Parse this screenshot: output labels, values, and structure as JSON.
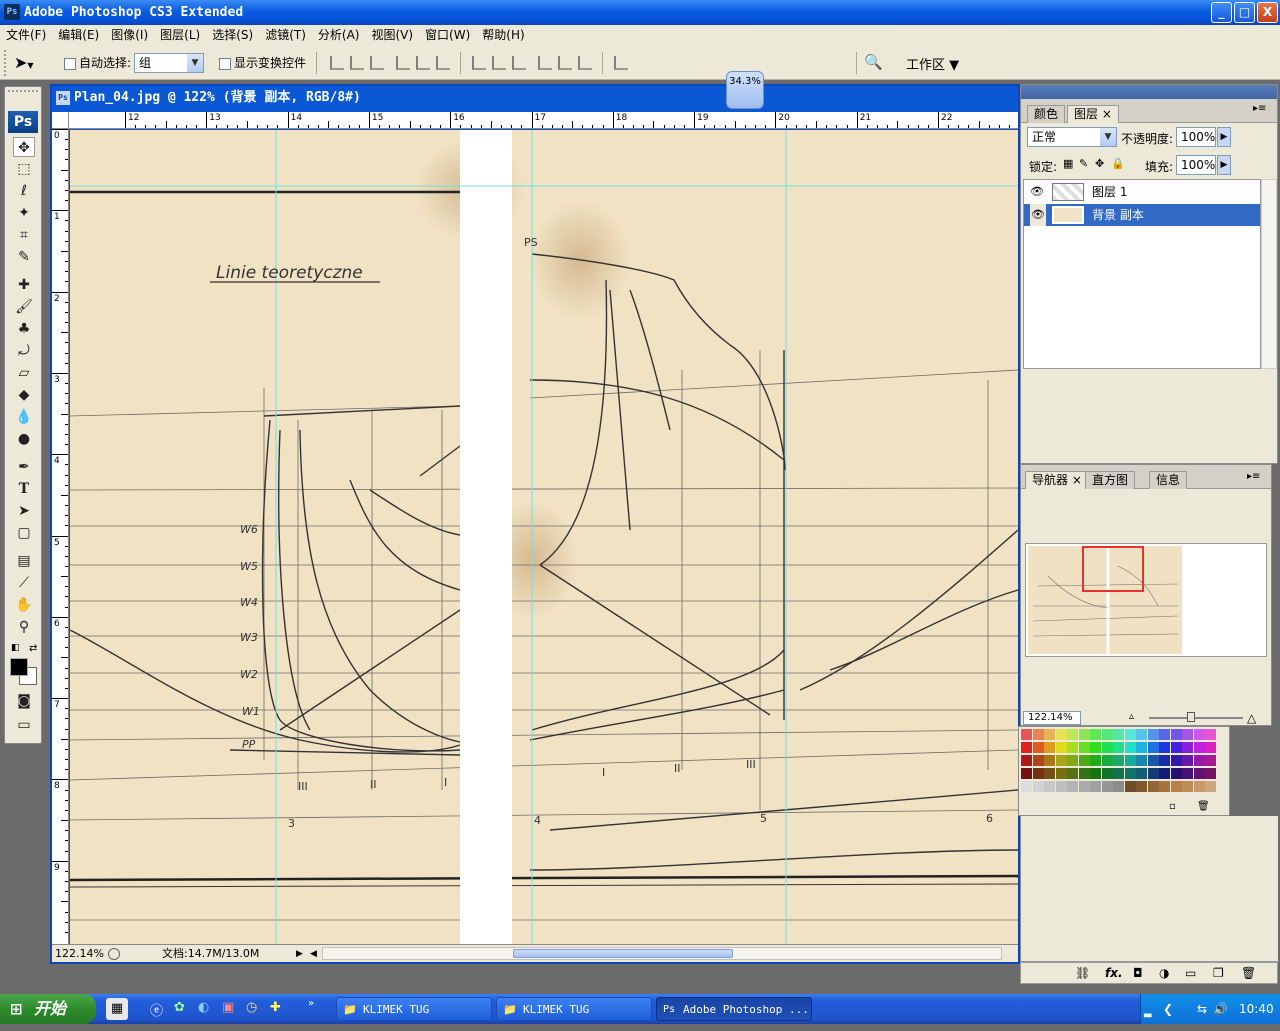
{
  "app": {
    "title": "Adobe Photoshop CS3 Extended",
    "icon_label": "Ps",
    "window_buttons": {
      "minimize": "_",
      "maximize": "□",
      "close": "X"
    }
  },
  "menu": [
    "文件(F)",
    "编辑(E)",
    "图像(I)",
    "图层(L)",
    "选择(S)",
    "滤镜(T)",
    "分析(A)",
    "视图(V)",
    "窗口(W)",
    "帮助(H)"
  ],
  "options": {
    "auto_select_label": "自动选择:",
    "auto_select_value": "组",
    "show_transform_label": "显示变换控件",
    "workspace_label": "工作区 ▼"
  },
  "toolbox": {
    "logo": "Ps"
  },
  "zoom_badge": "34.3%",
  "document": {
    "title": "Plan_04.jpg @ 122% (背景 副本, RGB/8#)",
    "zoom": "122.14%",
    "doc_size": "文档:14.7M/13.0M",
    "hruler_labels": [
      "12",
      "13",
      "14",
      "15",
      "16",
      "17",
      "18",
      "19",
      "20",
      "21",
      "22"
    ],
    "vruler_labels": [
      "0",
      "1",
      "2",
      "3",
      "4",
      "5",
      "6",
      "7",
      "8",
      "9"
    ],
    "drawing_text": {
      "heading": "Linie teoretyczne",
      "ps": "PS",
      "waterlines": [
        "W6",
        "W5",
        "W4",
        "W3",
        "W2",
        "W1",
        "PP"
      ],
      "stations": [
        "3",
        "4",
        "5",
        "6"
      ],
      "roman": [
        "III",
        "II",
        "I",
        "I",
        "II",
        "III"
      ]
    }
  },
  "layers_panel": {
    "tabs": [
      "颜色",
      "图层"
    ],
    "blend_mode": "正常",
    "opacity_label": "不透明度:",
    "opacity_value": "100%",
    "lock_label": "锁定:",
    "fill_label": "填充:",
    "fill_value": "100%",
    "layers": [
      {
        "name": "图层 1",
        "visible": true,
        "selected": false
      },
      {
        "name": "背景 副本",
        "visible": true,
        "selected": true
      }
    ],
    "bottom_icons": [
      "link-icon",
      "fx-icon",
      "mask-icon",
      "adjustment-icon",
      "group-icon",
      "new-layer-icon",
      "trash-icon"
    ],
    "fx_label": "fx."
  },
  "navigator_panel": {
    "tabs": [
      "导航器",
      "直方图",
      "信息"
    ],
    "zoom_value": "122.14%"
  },
  "taskbar": {
    "start": "开始",
    "items": [
      "KLIMEK TUG",
      "KLIMEK TUG",
      "Adobe Photoshop ..."
    ],
    "clock": "10:40"
  },
  "colors": {
    "xp_blue": "#0a58d6",
    "paper": "#f1e4c6",
    "selection": "#316ac5",
    "guide": "#5fe0e8"
  }
}
